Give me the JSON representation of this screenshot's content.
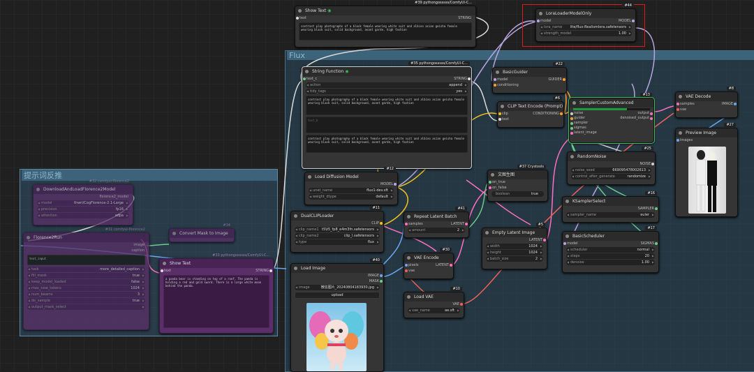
{
  "groups": {
    "flux": "Flux",
    "prompt_reverse": "提示词反推"
  },
  "nodes": {
    "show_text": {
      "title": "Show Text",
      "badge": "#39 pythongosssss/ComfyUI-C...",
      "in": "text",
      "out": "STRING",
      "text": "contrast play photographs of a black female wearing white suit and albino asian geisha female wearing black suit, solid background, avant garde, high fashion"
    },
    "lora": {
      "title": "LoraLoaderModelOnly",
      "badge": "#44",
      "in": "model",
      "out": "MODEL",
      "w1_label": "lora_name",
      "w1_value": "lite/flux-Realismlora.safetensors",
      "w2_label": "strength_model",
      "w2_value": "1.00"
    },
    "string_function": {
      "title": "String Function",
      "badge": "#35 pythongosssss/ComfyUI-C...",
      "in": "text_c",
      "out": "STRING",
      "w1_label": "action",
      "w1_value": "append",
      "w2_label": "tidy_tags",
      "w2_value": "yes",
      "text_a": "contrast play photography of a black female wearing white suit and albino asian geisha female wearing black suit, solid background, avant garde, high fashion",
      "text_b": "text_b",
      "text_out": "contrast play photography of a black female wearing white suit and albino asian geisha female wearing black suit, solid background, avant garde, high fashion"
    },
    "basic_guider": {
      "title": "BasicGuider",
      "badge": "#22",
      "in1": "model",
      "in2": "conditioning",
      "out": "GUIDER"
    },
    "clip_encode": {
      "title": "CLIP Text Encode (Prompt)",
      "badge": "#6",
      "in1": "clip",
      "in2": "text",
      "out": "CONDITIONING"
    },
    "sampler_adv": {
      "title": "SamplerCustomAdvanced",
      "badge": "#13",
      "inputs": [
        "noise",
        "guider",
        "sampler",
        "sigmas",
        "latent_image"
      ],
      "out1": "output",
      "out2": "denoised_output"
    },
    "vae_decode": {
      "title": "VAE Decode",
      "badge": "#8",
      "in1": "samples",
      "in2": "vae",
      "out": "IMAGE"
    },
    "preview": {
      "title": "Preview Image",
      "badge": "#27",
      "in": "images"
    },
    "random_noise": {
      "title": "RandomNoise",
      "badge": "#25",
      "out": "NOISE",
      "w1_label": "noise_seed",
      "w1_value": "669095478002613",
      "w2_label": "control_after_generate",
      "w2_value": "randomize"
    },
    "ksampler_select": {
      "title": "KSamplerSelect",
      "badge": "#16",
      "out": "SAMPLER",
      "w1_label": "sampler_name",
      "w1_value": "euler"
    },
    "basic_scheduler": {
      "title": "BasicScheduler",
      "badge": "#17",
      "in": "model",
      "out": "SIGMAS",
      "w1_label": "scheduler",
      "w1_value": "normal",
      "w2_label": "steps",
      "w2_value": "20",
      "w3_label": "denoise",
      "w3_value": "1.00"
    },
    "load_diffusion": {
      "title": "Load Diffusion Model",
      "badge": "#12",
      "out": "MODEL",
      "w1_label": "unet_name",
      "w1_value": "flux1-dev.sft",
      "w2_label": "weight_dtype",
      "w2_value": "default"
    },
    "dual_clip": {
      "title": "DualCLIPLoader",
      "badge": "#11",
      "out": "CLIP",
      "w1_label": "clip_name1",
      "w1_value": "t5\\t5_fp8_e4m3fn.safetensors",
      "w2_label": "clip_name2",
      "w2_value": "clip_l.safetensors",
      "w3_label": "type",
      "w3_value": "flux"
    },
    "wenshengtu": {
      "title": "文图生图",
      "badge": "#37 Crystools",
      "in1": "on_true",
      "in2": "on_false",
      "w1_label": "boolean",
      "w1_value": "true"
    },
    "repeat_latent": {
      "title": "Repeat Latent Batch",
      "badge": "#41",
      "in": "samples",
      "out": "LATENT",
      "w1_label": "amount",
      "w1_value": "2"
    },
    "empty_latent": {
      "title": "Empty Latent Image",
      "badge": "#5",
      "out": "LATENT",
      "w1_label": "width",
      "w1_value": "1024",
      "w2_label": "height",
      "w2_value": "1024",
      "w3_label": "batch_size",
      "w3_value": "2"
    },
    "vae_encode": {
      "title": "VAE Encode",
      "badge": "#30",
      "in1": "pixels",
      "in2": "vae",
      "out": "LATENT"
    },
    "load_vae": {
      "title": "Load VAE",
      "badge": "#10",
      "out": "VAE",
      "w1_label": "vae_name",
      "w1_value": "ae.sft"
    },
    "load_image": {
      "title": "Load Image",
      "badge": "#40",
      "out1": "IMAGE",
      "out2": "MASK",
      "w1_label": "image",
      "w1_value": "微信图片_20240804183930.jpg",
      "upload": "upload"
    },
    "p_node1": {
      "title": "DownloadAndLoadFlorence2Model",
      "badge": "#32 comfyui-florence2",
      "out": "florence2_model",
      "w1_label": "model",
      "w1_value": "thwri/CogFlorence-2.1-Large",
      "w2_label": "precision",
      "w2_value": "fp16",
      "w3_label": "attention",
      "w3_value": "sdpa"
    },
    "p_node2": {
      "title": "Florence2Run",
      "badge": "#31 comfyui-florence2",
      "out1": "image",
      "out2": "caption",
      "text": "text_input",
      "rows": [
        [
          "task",
          "more_detailed_caption"
        ],
        [
          "fill_mask",
          "true"
        ],
        [
          "keep_model_loaded",
          "false"
        ],
        [
          "max_new_tokens",
          "1024"
        ],
        [
          "num_beams",
          "3"
        ],
        [
          "do_sample",
          "true"
        ],
        [
          "output_mask_select",
          ""
        ]
      ]
    },
    "p_node3": {
      "title": "Convert Mask to Image",
      "badge": "#34"
    },
    "p_node4": {
      "title": "Show Text",
      "badge": "#33 pythongosssss/ComfyUI-C...",
      "in": "text",
      "out": "STRING",
      "text": "a panda bear is standing on top of a roof. The panda is holding a red and gold sword. There is a large white moon behind the panda."
    }
  }
}
